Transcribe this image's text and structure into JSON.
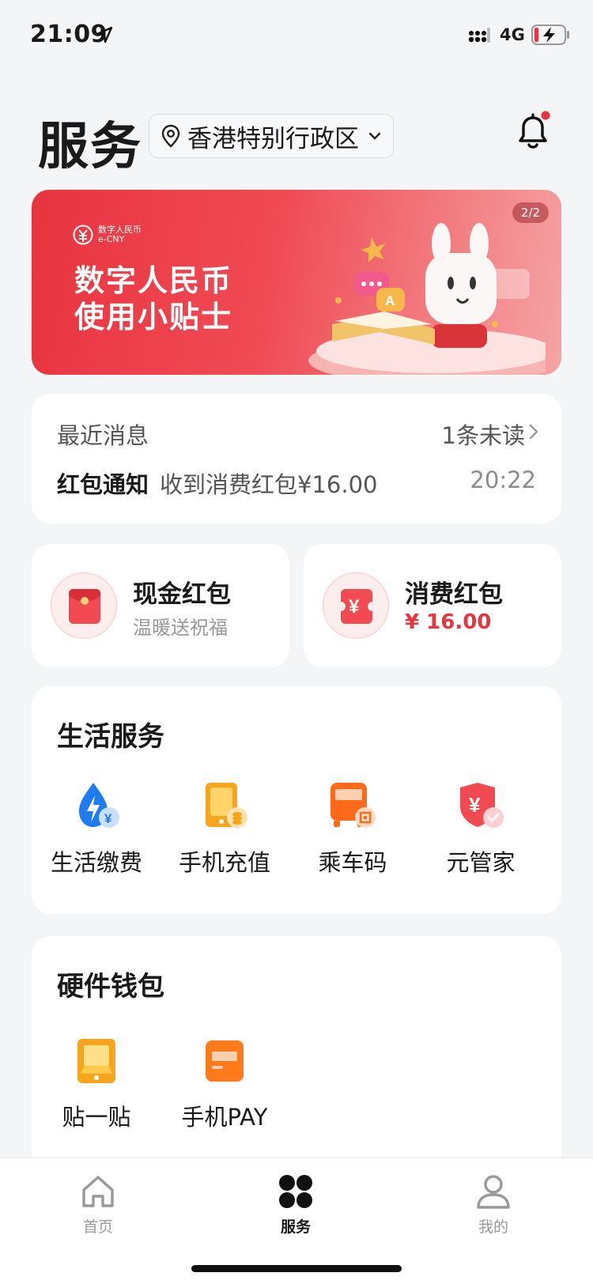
{
  "status_bar": {
    "time": "21:09",
    "network": "4G"
  },
  "header": {
    "title": "服务",
    "location": "香港特别行政区"
  },
  "banner": {
    "pager": "2/2",
    "brand_cn": "数字人民币",
    "brand_en": "e-CNY",
    "line1": "数字人民币",
    "line2": "使用小贴士"
  },
  "messages": {
    "title": "最近消息",
    "unread": "1条未读",
    "type": "红包通知",
    "body": "收到消费红包¥16.00",
    "time": "20:22"
  },
  "red_packets": [
    {
      "title": "现金红包",
      "subtitle": "温暖送祝福"
    },
    {
      "title": "消费红包",
      "amount": "¥ 16.00"
    }
  ],
  "life_services": {
    "title": "生活服务",
    "items": [
      {
        "label": "生活缴费",
        "icon": "utility-bill-icon"
      },
      {
        "label": "手机充值",
        "icon": "phone-topup-icon"
      },
      {
        "label": "乘车码",
        "icon": "bus-code-icon"
      },
      {
        "label": "元管家",
        "icon": "yuan-shield-icon"
      }
    ]
  },
  "hardware_wallet": {
    "title": "硬件钱包",
    "items": [
      {
        "label": "贴一贴",
        "icon": "tap-pay-icon"
      },
      {
        "label": "手机PAY",
        "icon": "card-icon"
      }
    ]
  },
  "tabbar": {
    "items": [
      {
        "label": "首页",
        "icon": "home-icon",
        "active": false
      },
      {
        "label": "服务",
        "icon": "grid-icon",
        "active": true
      },
      {
        "label": "我的",
        "icon": "user-icon",
        "active": false
      }
    ]
  },
  "colors": {
    "accent_red": "#E8343F",
    "orange": "#FF7A1A",
    "blue": "#1E7BF0"
  }
}
